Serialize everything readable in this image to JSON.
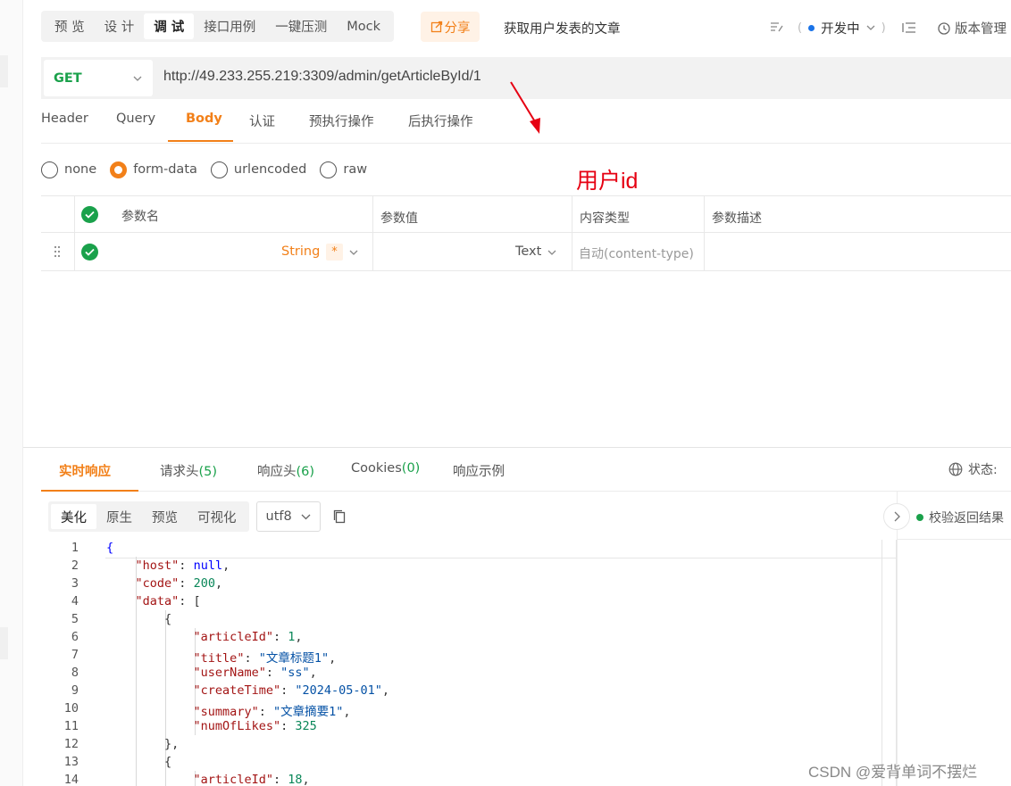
{
  "toolbar": {
    "tabs": [
      {
        "label": "预 览"
      },
      {
        "label": "设 计"
      },
      {
        "label": "调 试"
      },
      {
        "label": "接口用例"
      },
      {
        "label": "一键压测"
      },
      {
        "label": "Mock"
      }
    ],
    "share_label": "分享",
    "api_name": "获取用户发表的文章",
    "status_label": "开发中",
    "version_label": "版本管理"
  },
  "request": {
    "method": "GET",
    "url": "http://49.233.255.219:3309/admin/getArticleById/1",
    "tabs": [
      {
        "label": "Header"
      },
      {
        "label": "Query"
      },
      {
        "label": "Body"
      },
      {
        "label": "认证"
      },
      {
        "label": "预执行操作"
      },
      {
        "label": "后执行操作"
      }
    ],
    "body_types": [
      {
        "label": "none"
      },
      {
        "label": "form-data"
      },
      {
        "label": "urlencoded"
      },
      {
        "label": "raw"
      }
    ],
    "params_table": {
      "headers": [
        "参数名",
        "参数值",
        "内容类型",
        "参数描述"
      ],
      "row": {
        "type": "String",
        "required_mark": "*",
        "value_type": "Text",
        "content_type_placeholder": "自动(content-type)"
      }
    }
  },
  "annotation": {
    "text": "用户id",
    "color": "#e60012"
  },
  "response": {
    "tabs": [
      {
        "label": "实时响应",
        "count": ""
      },
      {
        "label": "请求头",
        "count": "(5)"
      },
      {
        "label": "响应头",
        "count": "(6)"
      },
      {
        "label": "Cookies",
        "count": "(0)"
      },
      {
        "label": "响应示例",
        "count": ""
      }
    ],
    "status_label": "状态:",
    "format_buttons": [
      {
        "label": "美化"
      },
      {
        "label": "原生"
      },
      {
        "label": "预览"
      },
      {
        "label": "可视化"
      }
    ],
    "encoding": "utf8",
    "validate_label": "校验返回结果",
    "code_lines": [
      {
        "no": "1",
        "text": "{"
      },
      {
        "no": "2",
        "text": "    \"host\": null,"
      },
      {
        "no": "3",
        "text": "    \"code\": 200,"
      },
      {
        "no": "4",
        "text": "    \"data\": ["
      },
      {
        "no": "5",
        "text": "        {"
      },
      {
        "no": "6",
        "text": "            \"articleId\": 1,"
      },
      {
        "no": "7",
        "text": "            \"title\": \"文章标题1\","
      },
      {
        "no": "8",
        "text": "            \"userName\": \"ss\","
      },
      {
        "no": "9",
        "text": "            \"createTime\": \"2024-05-01\","
      },
      {
        "no": "10",
        "text": "            \"summary\": \"文章摘要1\","
      },
      {
        "no": "11",
        "text": "            \"numOfLikes\": 325"
      },
      {
        "no": "12",
        "text": "        },"
      },
      {
        "no": "13",
        "text": "        {"
      },
      {
        "no": "14",
        "text": "            \"articleId\": 18,"
      }
    ]
  },
  "watermark": "CSDN @爱背单词不摆烂",
  "colors": {
    "accent": "#f28019",
    "success": "#1aa14b",
    "annotation": "#e60012"
  }
}
